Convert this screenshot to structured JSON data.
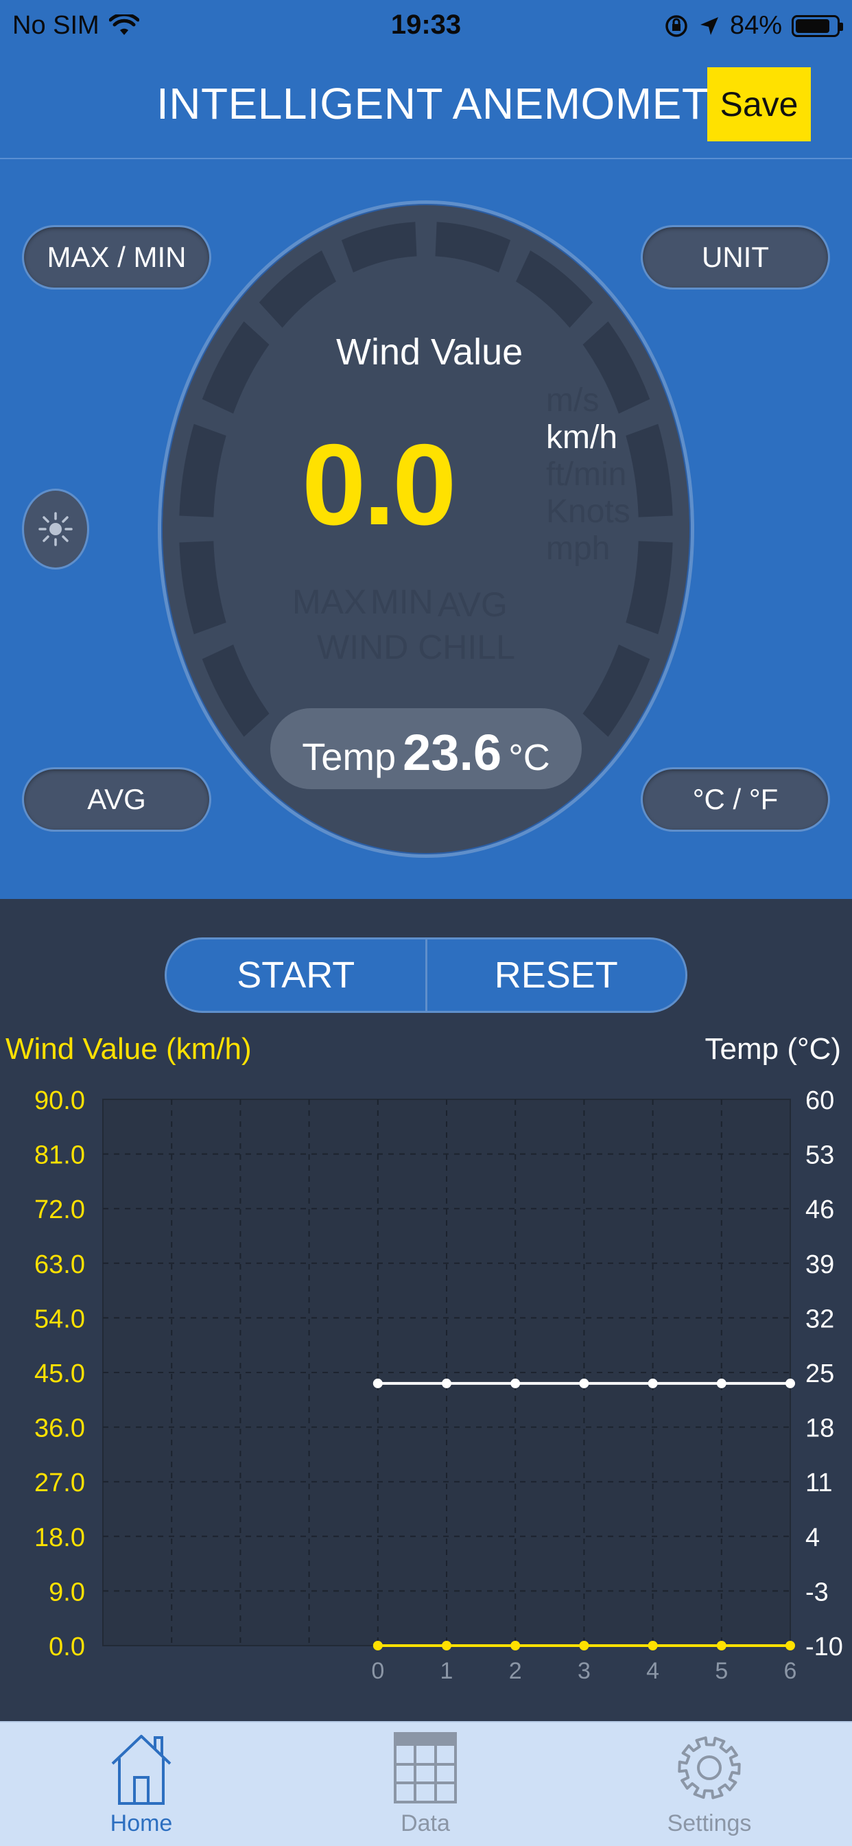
{
  "status_bar": {
    "carrier": "No SIM",
    "time": "19:33",
    "battery_percent": "84%",
    "battery_level": 0.84
  },
  "header": {
    "title": "INTELLIGENT ANEMOMETER",
    "save_label": "Save"
  },
  "controls": {
    "max_min_label": "MAX / MIN",
    "unit_label": "UNIT",
    "avg_label": "AVG",
    "temp_unit_label": "°C / °F",
    "start_label": "START",
    "reset_label": "RESET"
  },
  "gauge": {
    "title": "Wind Value",
    "value": "0.0",
    "units": [
      "m/s",
      "km/h",
      "ft/min",
      "Knots",
      "mph"
    ],
    "active_unit": "km/h",
    "modes": {
      "max": "MAX",
      "min": "MIN",
      "avg": "AVG",
      "wind_chill": "WIND CHILL"
    },
    "temp_label": "Temp",
    "temp_value": "23.6",
    "temp_unit": "°C"
  },
  "chart_data": {
    "type": "line",
    "left_axis_label": "Wind Value (km/h)",
    "right_axis_label": "Temp (°C)",
    "x": [
      0,
      1,
      2,
      3,
      4,
      5,
      6
    ],
    "x_tick_labels": [
      "0",
      "1",
      "2",
      "3",
      "4",
      "5",
      "6"
    ],
    "y_left_ticks": [
      "90.0",
      "81.0",
      "72.0",
      "63.0",
      "54.0",
      "45.0",
      "36.0",
      "27.0",
      "18.0",
      "9.0",
      "0.0"
    ],
    "y_right_ticks": [
      "60",
      "53",
      "46",
      "39",
      "32",
      "25",
      "18",
      "11",
      "4",
      "-3",
      "-10"
    ],
    "y_left_range": [
      0,
      90
    ],
    "y_right_range": [
      -10,
      60
    ],
    "x_range": [
      -4,
      6
    ],
    "grid": true,
    "series": [
      {
        "axis": "left",
        "color": "#ffe100",
        "values": [
          0,
          0,
          0,
          0,
          0,
          0,
          0
        ]
      },
      {
        "axis": "right",
        "color": "#ffffff",
        "values": [
          23.6,
          23.6,
          23.6,
          23.6,
          23.6,
          23.6,
          23.6
        ]
      }
    ]
  },
  "tabs": [
    {
      "label": "Home",
      "icon": "home-icon",
      "active": true
    },
    {
      "label": "Data",
      "icon": "grid-icon",
      "active": false
    },
    {
      "label": "Settings",
      "icon": "gear-icon",
      "active": false
    }
  ],
  "colors": {
    "accent": "#2d6fc0",
    "highlight": "#ffe100",
    "panel": "#2e3a4f",
    "tab_active": "#2d6fc0",
    "tab_inactive": "#8b96a6"
  }
}
